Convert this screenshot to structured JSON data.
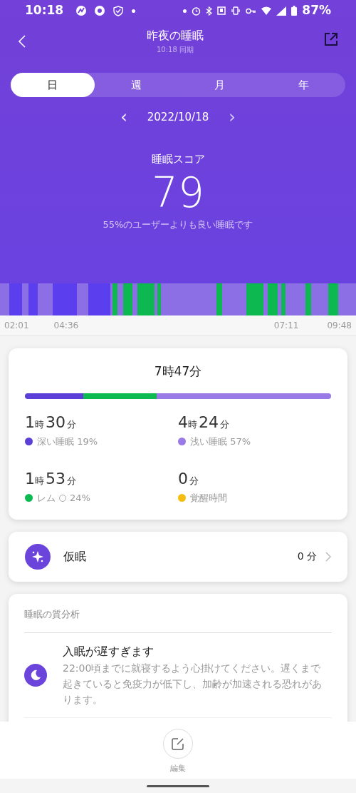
{
  "status_bar": {
    "time": "10:18",
    "battery": "87%"
  },
  "header": {
    "title": "昨夜の睡眠",
    "subtitle": "10:18 同期"
  },
  "tabs": [
    {
      "label": "日",
      "selected": true
    },
    {
      "label": "週",
      "selected": false
    },
    {
      "label": "月",
      "selected": false
    },
    {
      "label": "年",
      "selected": false
    }
  ],
  "date_nav": {
    "prev": "‹",
    "date": "2022/10/18",
    "next": "›"
  },
  "score": {
    "label": "睡眠スコア",
    "value": "79",
    "comparison": "55%のユーザーよりも良い睡眠です"
  },
  "timeline": {
    "ticks": [
      "02:01",
      "04:36",
      "07:11",
      "09:48"
    ]
  },
  "summary": {
    "total": "7時47分",
    "stages": [
      {
        "hours": "1",
        "hour_unit": "時",
        "minutes": "30",
        "minute_unit": "分",
        "label": "深い睡眠 19%",
        "color": "#5b3fd6",
        "level": 0.19,
        "kind": "deep",
        "help": false
      },
      {
        "hours": "4",
        "hour_unit": "時",
        "minutes": "24",
        "minute_unit": "分",
        "label": "浅い睡眠 57%",
        "color": "#9a7ae6",
        "level": 0.57,
        "kind": "light",
        "help": false
      },
      {
        "hours": "1",
        "hour_unit": "時",
        "minutes": "53",
        "minute_unit": "分",
        "label": "レム",
        "percent": "24%",
        "color": "#0dba52",
        "level": 0.24,
        "kind": "rem",
        "help": true
      },
      {
        "minutes": "0",
        "minute_unit": "分",
        "label": "覚醒時間",
        "color": "#f5bd0e",
        "kind": "awake",
        "help": false
      }
    ]
  },
  "nap": {
    "label": "仮眠",
    "value": "0 分"
  },
  "analysis": {
    "title": "睡眠の質分析",
    "items": [
      {
        "title": "入眠が遅すぎます",
        "text": "22:00頃までに就寝するよう心掛けてください。遅くまで起きていると免疫力が低下し、加齢が加速される恐れがあります。"
      }
    ]
  },
  "bottom": {
    "edit": "編集"
  }
}
